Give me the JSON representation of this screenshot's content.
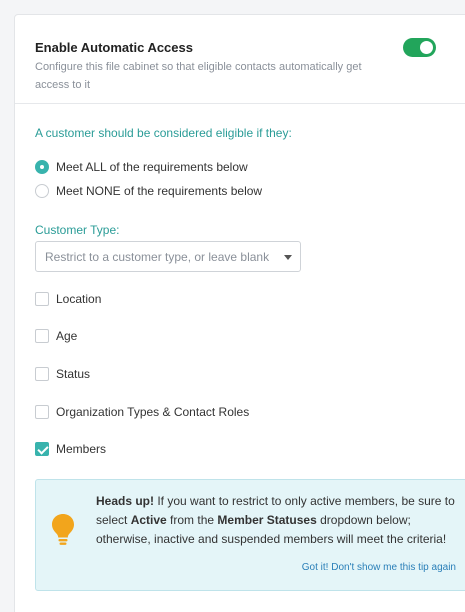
{
  "header": {
    "title": "Enable Automatic Access",
    "description": "Configure this file cabinet so that eligible contacts automatically get access to it",
    "toggle_on": true
  },
  "eligibility": {
    "label": "A customer should be considered eligible if they:",
    "options": [
      {
        "label": "Meet ALL of the requirements below",
        "selected": true
      },
      {
        "label": "Meet NONE of the requirements below",
        "selected": false
      }
    ]
  },
  "customer_type": {
    "label": "Customer Type:",
    "placeholder": "Restrict to a customer type, or leave blank"
  },
  "criteria": [
    {
      "label": "Location",
      "checked": false
    },
    {
      "label": "Age",
      "checked": false
    },
    {
      "label": "Status",
      "checked": false
    },
    {
      "label": "Organization Types & Contact Roles",
      "checked": false
    },
    {
      "label": "Members",
      "checked": true
    }
  ],
  "tip": {
    "heading": "Heads up!",
    "text_1": " If you want to restrict to only active members, be sure to select ",
    "bold_1": "Active",
    "text_2": " from the ",
    "bold_2": "Member Statuses",
    "text_3": " dropdown below; otherwise, inactive and suspended members will meet the criteria!",
    "dismiss_link": "Got it! Don't show me this tip again",
    "icon": "lightbulb-icon"
  },
  "colors": {
    "accent": "#38b3ad",
    "toggle_on": "#22a55b",
    "tip_background": "#e4f5f8",
    "bulb": "#f2a51c"
  }
}
